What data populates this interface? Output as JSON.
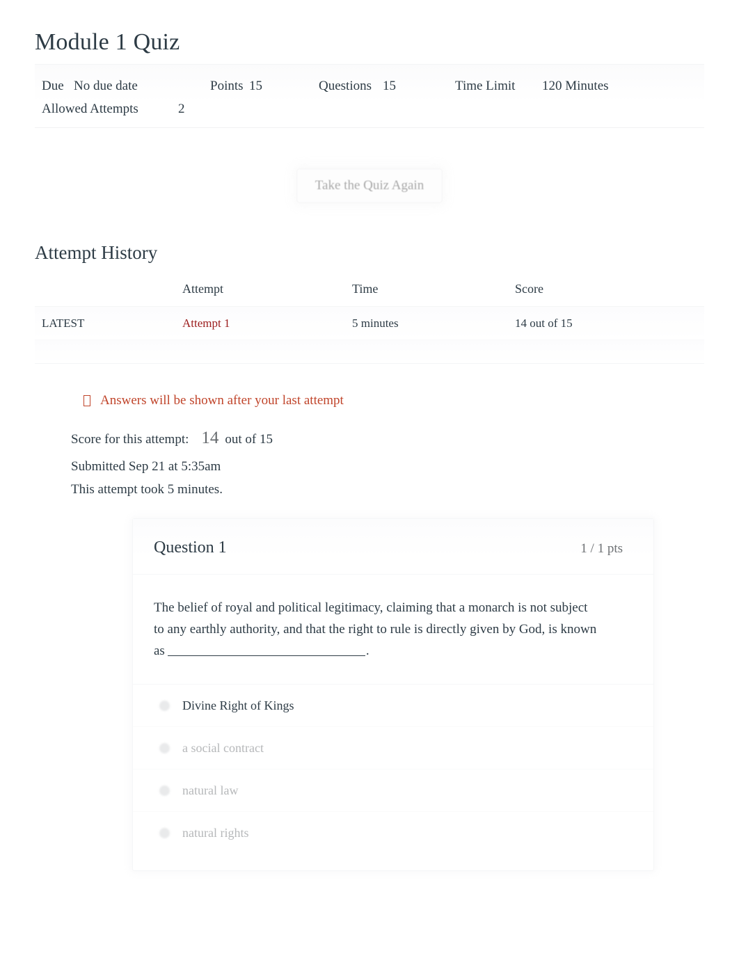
{
  "quiz": {
    "title": "Module 1 Quiz",
    "details": {
      "due_label": "Due",
      "due_value": "No due date",
      "points_label": "Points",
      "points_value": "15",
      "questions_label": "Questions",
      "questions_value": "15",
      "time_limit_label": "Time Limit",
      "time_limit_value": "120 Minutes",
      "allowed_attempts_label": "Allowed Attempts",
      "allowed_attempts_value": "2"
    }
  },
  "actions": {
    "take_again_label": "Take the Quiz Again"
  },
  "attempt_history": {
    "heading": "Attempt History",
    "columns": {
      "kind": "",
      "attempt": "Attempt",
      "time": "Time",
      "score": "Score"
    },
    "rows": [
      {
        "kind": "LATEST",
        "attempt": "Attempt 1",
        "time": "5 minutes",
        "score": "14 out of 15"
      }
    ]
  },
  "notice": {
    "icon": "warning-box-icon",
    "text": "Answers will be shown after your last attempt",
    "color": "#c0442a"
  },
  "attempt_summary": {
    "score_label": "Score for this attempt:",
    "score_value": "14",
    "score_out_of": "out of 15",
    "submitted": "Submitted Sep 21 at 5:35am",
    "duration": "This attempt took 5 minutes."
  },
  "questions": [
    {
      "name": "Question 1",
      "points": "1 / 1 pts",
      "text_before_blank": "The belief of royal and political legitimacy, claiming that a monarch is not subject to any earthly authority, and that the right to rule is directly given by God, is known as",
      "text_after_blank": ".",
      "answers": [
        {
          "label": "Divine Right of Kings",
          "state": "selected"
        },
        {
          "label": "a social contract",
          "state": "faded"
        },
        {
          "label": "natural law",
          "state": "faded"
        },
        {
          "label": "natural rights",
          "state": "faded"
        }
      ]
    }
  ],
  "colors": {
    "link_red": "#9b1c1c",
    "notice_orange": "#c0442a",
    "text": "#2d3b45",
    "muted": "#b6b8ba"
  }
}
